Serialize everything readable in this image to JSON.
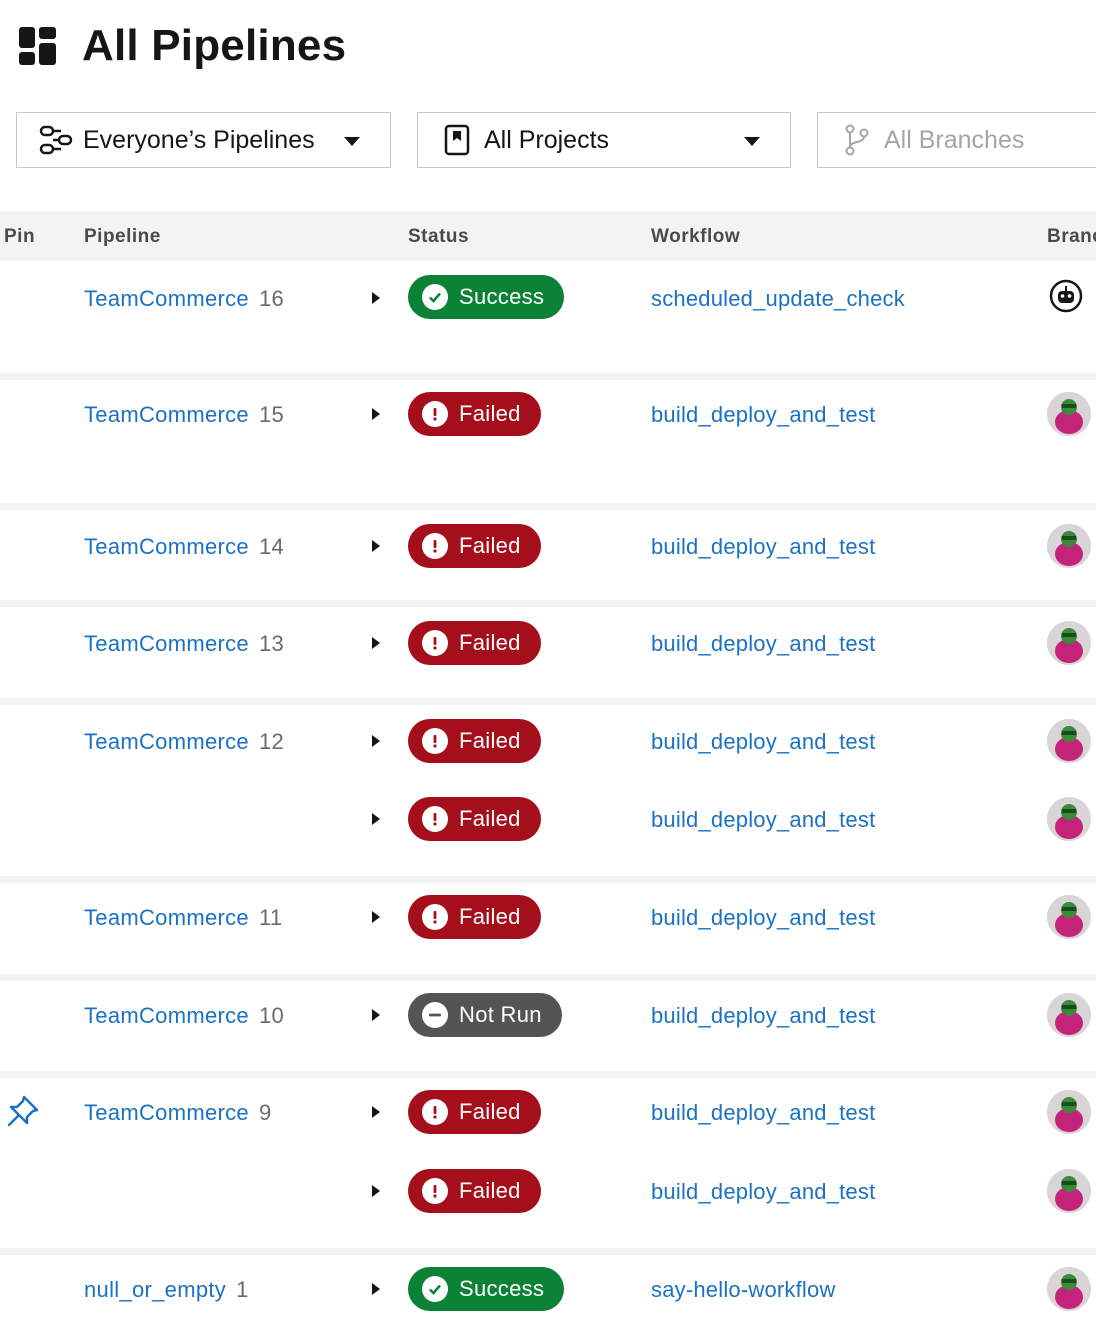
{
  "page": {
    "title": "All Pipelines"
  },
  "filters": {
    "pipelines": "Everyone’s Pipelines",
    "projects": "All Projects",
    "branches": "All Branches"
  },
  "columns": {
    "pin": "Pin",
    "pipeline": "Pipeline",
    "status": "Status",
    "workflow": "Workflow",
    "branch": "Branc"
  },
  "rows": [
    {
      "project": "TeamCommerce",
      "number": "16",
      "pinned": false,
      "workflows": [
        {
          "status": "Success",
          "kind": "success",
          "name": "scheduled_update_check",
          "actor": "robot-icon"
        }
      ]
    },
    {
      "project": "TeamCommerce",
      "number": "15",
      "pinned": false,
      "workflows": [
        {
          "status": "Failed",
          "kind": "failed",
          "name": "build_deploy_and_test",
          "actor": "avatar"
        }
      ]
    },
    {
      "project": "TeamCommerce",
      "number": "14",
      "pinned": false,
      "workflows": [
        {
          "status": "Failed",
          "kind": "failed",
          "name": "build_deploy_and_test",
          "actor": "avatar"
        }
      ]
    },
    {
      "project": "TeamCommerce",
      "number": "13",
      "pinned": false,
      "workflows": [
        {
          "status": "Failed",
          "kind": "failed",
          "name": "build_deploy_and_test",
          "actor": "avatar"
        }
      ]
    },
    {
      "project": "TeamCommerce",
      "number": "12",
      "pinned": false,
      "workflows": [
        {
          "status": "Failed",
          "kind": "failed",
          "name": "build_deploy_and_test",
          "actor": "avatar"
        },
        {
          "status": "Failed",
          "kind": "failed",
          "name": "build_deploy_and_test",
          "actor": "avatar"
        }
      ]
    },
    {
      "project": "TeamCommerce",
      "number": "11",
      "pinned": false,
      "workflows": [
        {
          "status": "Failed",
          "kind": "failed",
          "name": "build_deploy_and_test",
          "actor": "avatar"
        }
      ]
    },
    {
      "project": "TeamCommerce",
      "number": "10",
      "pinned": false,
      "workflows": [
        {
          "status": "Not Run",
          "kind": "notrun",
          "name": "build_deploy_and_test",
          "actor": "avatar"
        }
      ]
    },
    {
      "project": "TeamCommerce",
      "number": "9",
      "pinned": true,
      "workflows": [
        {
          "status": "Failed",
          "kind": "failed",
          "name": "build_deploy_and_test",
          "actor": "avatar"
        },
        {
          "status": "Failed",
          "kind": "failed",
          "name": "build_deploy_and_test",
          "actor": "avatar"
        }
      ]
    },
    {
      "project": "null_or_empty",
      "number": "1",
      "pinned": false,
      "workflows": [
        {
          "status": "Success",
          "kind": "success",
          "name": "say-hello-workflow",
          "actor": "avatar"
        }
      ]
    }
  ],
  "colors": {
    "link": "#1b71c4",
    "success": "#0b8235",
    "failed": "#a50e1b",
    "notrun": "#545454"
  }
}
